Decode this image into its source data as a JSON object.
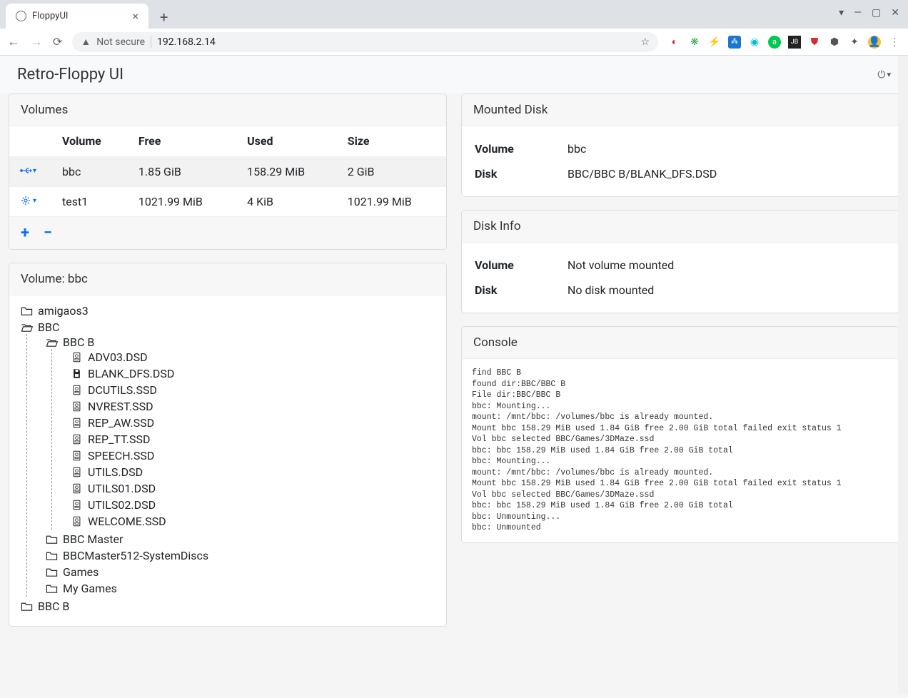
{
  "browser": {
    "tab_title": "FloppyUI",
    "not_secure": "Not secure",
    "url": "192.168.2.14"
  },
  "app": {
    "title": "Retro-Floppy UI"
  },
  "volumes_panel": {
    "title": "Volumes",
    "headers": {
      "volume": "Volume",
      "free": "Free",
      "used": "Used",
      "size": "Size"
    },
    "rows": [
      {
        "icon": "usb",
        "name": "bbc",
        "free": "1.85 GiB",
        "used": "158.29 MiB",
        "size": "2 GiB",
        "selected": true
      },
      {
        "icon": "gear",
        "name": "test1",
        "free": "1021.99 MiB",
        "used": "4 KiB",
        "size": "1021.99 MiB",
        "selected": false
      }
    ]
  },
  "mounted": {
    "title": "Mounted Disk",
    "labels": {
      "volume": "Volume",
      "disk": "Disk"
    },
    "volume": "bbc",
    "disk": "BBC/BBC B/BLANK_DFS.DSD"
  },
  "volume_tree": {
    "title": "Volume: bbc",
    "root": [
      {
        "name": "amigaos3",
        "type": "folder"
      },
      {
        "name": "BBC",
        "type": "folder-open",
        "children": [
          {
            "name": "BBC B",
            "type": "folder-open",
            "children": [
              {
                "name": "ADV03.DSD",
                "type": "file"
              },
              {
                "name": "BLANK_DFS.DSD",
                "type": "disk"
              },
              {
                "name": "DCUTILS.SSD",
                "type": "file"
              },
              {
                "name": "NVREST.SSD",
                "type": "file"
              },
              {
                "name": "REP_AW.SSD",
                "type": "file"
              },
              {
                "name": "REP_TT.SSD",
                "type": "file"
              },
              {
                "name": "SPEECH.SSD",
                "type": "file"
              },
              {
                "name": "UTILS.DSD",
                "type": "file"
              },
              {
                "name": "UTILS01.DSD",
                "type": "file"
              },
              {
                "name": "UTILS02.DSD",
                "type": "file"
              },
              {
                "name": "WELCOME.SSD",
                "type": "file"
              }
            ]
          },
          {
            "name": "BBC Master",
            "type": "folder"
          },
          {
            "name": "BBCMaster512-SystemDiscs",
            "type": "folder"
          },
          {
            "name": "Games",
            "type": "folder"
          },
          {
            "name": "My Games",
            "type": "folder"
          }
        ]
      },
      {
        "name": "BBC B",
        "type": "folder"
      }
    ]
  },
  "disk_info": {
    "title": "Disk Info",
    "labels": {
      "volume": "Volume",
      "disk": "Disk"
    },
    "volume": "Not volume mounted",
    "disk": "No disk mounted"
  },
  "console": {
    "title": "Console",
    "text": "find BBC B\nfound dir:BBC/BBC B\nFile dir:BBC/BBC B\nbbc: Mounting...\nmount: /mnt/bbc: /volumes/bbc is already mounted.\nMount bbc 158.29 MiB used 1.84 GiB free 2.00 GiB total failed exit status 1\nVol bbc selected BBC/Games/3DMaze.ssd\nbbc: bbc 158.29 MiB used 1.84 GiB free 2.00 GiB total\nbbc: Mounting...\nmount: /mnt/bbc: /volumes/bbc is already mounted.\nMount bbc 158.29 MiB used 1.84 GiB free 2.00 GiB total failed exit status 1\nVol bbc selected BBC/Games/3DMaze.ssd\nbbc: bbc 158.29 MiB used 1.84 GiB free 2.00 GiB total\nbbc: Unmounting...\nbbc: Unmounted"
  }
}
